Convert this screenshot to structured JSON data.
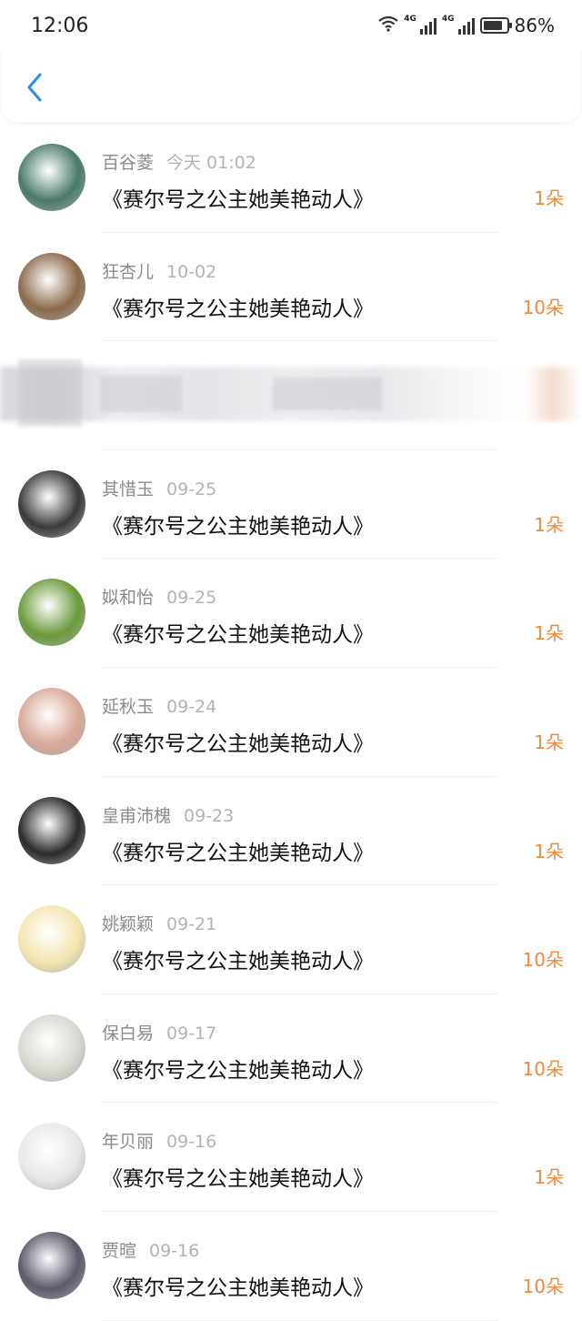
{
  "status_bar": {
    "time": "12:06",
    "network_1": "4G",
    "network_2": "4G",
    "battery": "86%"
  },
  "header": {
    "back_icon": "chevron-left-icon"
  },
  "colors": {
    "accent_blue": "#2b8cf0",
    "count_orange": "#f08a3c"
  },
  "list": [
    {
      "name": "百谷菱",
      "date": "今天 01:02",
      "title": "《赛尔号之公主她美艳动人》",
      "count": "1朵",
      "avatar_color": "#4a7a6a"
    },
    {
      "name": "狂杏儿",
      "date": "10-02",
      "title": "《赛尔号之公主她美艳动人》",
      "count": "10朵",
      "avatar_color": "#8a6a4a"
    },
    {
      "name": "",
      "date": "",
      "title": "",
      "count": "",
      "avatar_color": "#9a9aa4"
    },
    {
      "name": "其惜玉",
      "date": "09-25",
      "title": "《赛尔号之公主她美艳动人》",
      "count": "1朵",
      "avatar_color": "#3a3a3a"
    },
    {
      "name": "姒和怡",
      "date": "09-25",
      "title": "《赛尔号之公主她美艳动人》",
      "count": "1朵",
      "avatar_color": "#6a9a3a"
    },
    {
      "name": "延秋玉",
      "date": "09-24",
      "title": "《赛尔号之公主她美艳动人》",
      "count": "1朵",
      "avatar_color": "#d8a898"
    },
    {
      "name": "皇甫沛槐",
      "date": "09-23",
      "title": "《赛尔号之公主她美艳动人》",
      "count": "1朵",
      "avatar_color": "#2a2a2a"
    },
    {
      "name": "姚颖颖",
      "date": "09-21",
      "title": "《赛尔号之公主她美艳动人》",
      "count": "10朵",
      "avatar_color": "#f3e6b0"
    },
    {
      "name": "保白易",
      "date": "09-17",
      "title": "《赛尔号之公主她美艳动人》",
      "count": "10朵",
      "avatar_color": "#d8d8d0"
    },
    {
      "name": "年贝丽",
      "date": "09-16",
      "title": "《赛尔号之公主她美艳动人》",
      "count": "1朵",
      "avatar_color": "#e8e8e8"
    },
    {
      "name": "贾暄",
      "date": "09-16",
      "title": "《赛尔号之公主她美艳动人》",
      "count": "10朵",
      "avatar_color": "#5a5a6a"
    }
  ]
}
